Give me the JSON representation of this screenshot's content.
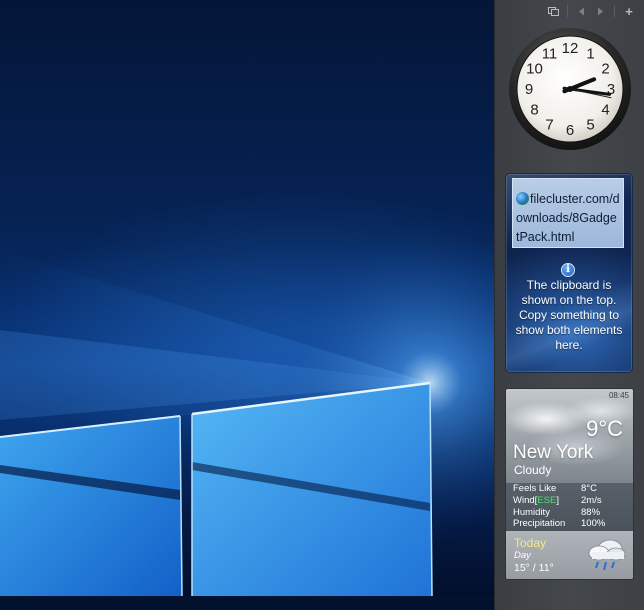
{
  "sidebar": {
    "toolbar": {
      "windows_icon": "windows-icon",
      "prev_icon": "chevron-left-icon",
      "next_icon": "chevron-right-icon",
      "add_label": "+"
    }
  },
  "clock": {
    "numerals": [
      "12",
      "1",
      "2",
      "3",
      "4",
      "5",
      "6",
      "7",
      "8",
      "9",
      "10",
      "11"
    ],
    "hour": 2,
    "minute": 16,
    "second": 17
  },
  "clipboard": {
    "entry_text": "filecluster.com/downloads/8GadgetPack.html",
    "info_text": "The clipboard is shown on the top. Copy something to show both elements here."
  },
  "weather": {
    "time": "08:45",
    "temperature": "9°C",
    "city": "New York",
    "condition": "Cloudy",
    "details": {
      "feels_like_label": "Feels Like",
      "feels_like_value": "8°C",
      "wind_label": "Wind",
      "wind_dir_open": "[",
      "wind_direction": "ESE",
      "wind_dir_close": "]",
      "wind_value": "2m/s",
      "humidity_label": "Humidity",
      "humidity_value": "88%",
      "precipitation_label": "Precipitation",
      "precipitation_value": "100%"
    },
    "forecast": {
      "label": "Today",
      "period": "Day",
      "temps": "15° /  11°"
    }
  }
}
